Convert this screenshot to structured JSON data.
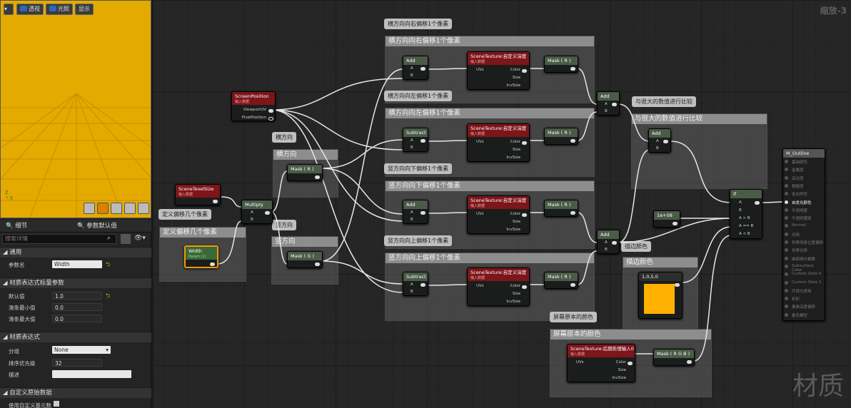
{
  "viewport": {
    "toolbar": [
      "透视",
      "光照",
      "显示"
    ]
  },
  "panel": {
    "tabs": [
      "细节",
      "参数默认值"
    ],
    "search_placeholder": "搜索详情",
    "sections": {
      "general": "通用",
      "scalar": "材质表达式标量参数",
      "expression": "材质表达式",
      "custom": "自定义原始数据"
    },
    "param_name_label": "参数名",
    "param_name": "Width",
    "default_label": "默认值",
    "default": "1.0",
    "slider_min_label": "滑条最小值",
    "slider_min": "0.0",
    "slider_max_label": "滑条最大值",
    "slider_max": "0.0",
    "group_label": "分组",
    "group": "None",
    "sort_label": "排序优先级",
    "sort": "32",
    "desc_label": "描述",
    "desc": "",
    "use_custom_label": "使用自定义基元数"
  },
  "graph": {
    "zoom": "缩放-3",
    "watermark": "材质",
    "comments": {
      "right": "横方向向右偏移1个像素",
      "left": "横方向向左偏移1个像素",
      "down": "竖方向向下偏移1个像素",
      "up": "竖方向向上偏移1个像素",
      "horiz": "横方向",
      "vert": "竖方向",
      "offset": "定义偏移几个像素",
      "compare": "与很大的数值进行比较",
      "edge": "描边颜色",
      "orig": "屏幕原本的颜色"
    },
    "nodes": {
      "add": "Add",
      "subtract": "Subtract",
      "multiply": "Multiply",
      "if": "If",
      "mask_r": "Mask ( R )",
      "mask_g": "Mask ( G )",
      "mask_rgb": "Mask ( R G B )",
      "scenetex": "SceneTexture:自定义深度",
      "scenetex_pp": "SceneTexture:后期处理输入0",
      "screenpos": "ScreenPosition",
      "texelsize": "SceneTexelSize",
      "input_data": "输入数据",
      "width": "Width",
      "width_sub": "Param (1)",
      "const": "1e+08",
      "color_val": "1,0,5,0",
      "uvs": "UVs",
      "color": "Color",
      "size": "Size",
      "invsize": "InvSize",
      "viewportuv": "ViewportUV",
      "pixelpos": "PixelPosition",
      "pin_a": "A",
      "pin_b": "B",
      "agb": "A > B",
      "aeb": "A == B",
      "alb": "A < B"
    },
    "output": {
      "title": "M_Outline",
      "pins": [
        "基础颜色",
        "金属度",
        "高光度",
        "粗糙度",
        "各向异性",
        "自发光颜色",
        "不透明度",
        "不透明蒙版",
        "Normal",
        "切线",
        "世界场景位置偏移",
        "世界位移",
        "曲面细分乘数",
        "Subsurface Color",
        "Custom Data 0",
        "Custom Data 1",
        "环境光遮挡",
        "折射",
        "像素深度偏移",
        "着色模型"
      ]
    }
  },
  "colors": {
    "viewport": "#e4aa00",
    "edge": "#ffb000",
    "node_red": "#7d151a",
    "node_green": "#4a5b48"
  }
}
